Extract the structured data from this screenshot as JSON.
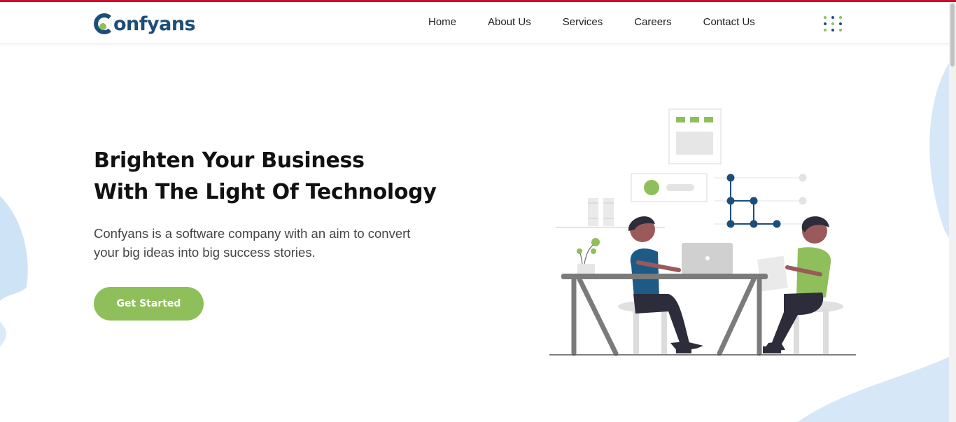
{
  "brand": {
    "name_rest": "onfyans",
    "logo_icon": "confyans-c-logo",
    "primary": "#1d4e7a",
    "accent": "#8fbf5a",
    "topline": "#c8102e"
  },
  "nav": {
    "items": [
      {
        "label": "Home"
      },
      {
        "label": "About Us"
      },
      {
        "label": "Services"
      },
      {
        "label": "Careers"
      },
      {
        "label": "Contact Us"
      }
    ],
    "menu_icon": "dots-grid-icon"
  },
  "hero": {
    "title_line1": "Brighten Your Business",
    "title_line2": "With The Light Of Technology",
    "description": "Confyans is a software company with an aim to convert your big ideas into big success stories.",
    "cta_label": "Get Started",
    "illustration": "two-people-working-at-desk-illustration"
  }
}
